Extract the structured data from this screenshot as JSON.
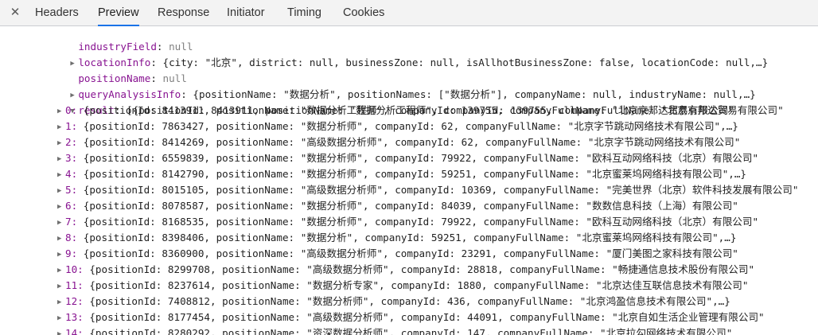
{
  "tabs": {
    "close_glyph": "✕",
    "items": [
      "Headers",
      "Preview",
      "Response",
      "Initiator",
      "Timing",
      "Cookies"
    ],
    "active": "Preview"
  },
  "preview": {
    "industry_field": {
      "key": "industryField",
      "value": "null"
    },
    "location_info": {
      "key": "locationInfo",
      "value": "{city: \"北京\", district: null, businessZone: null, isAllhotBusinessZone: false, locationCode: null,…}"
    },
    "position_name": {
      "key": "positionName",
      "value": "null"
    },
    "query_analysis_info": {
      "key": "queryAnalysisInfo",
      "value": "{positionName: \"数据分析\", positionNames: [\"数据分析\"], companyName: null, industryName: null,…}"
    },
    "result": {
      "key": "result",
      "value": "[{positionId: 8413911, positionName: \"数据分析工程师\", companyId: 139755, companyFullName: \"北京京邦达贸易有限公司\""
    },
    "rows": [
      "{positionId: 8413911, positionName: \"数据分析工程师\", companyId: 139755, companyFullName: \"北京京邦达贸易有限公司\"",
      "{positionId: 7863427, positionName: \"数据分析师\", companyId: 62, companyFullName: \"北京字节跳动网络技术有限公司\",…}",
      "{positionId: 8414269, positionName: \"高级数据分析师\", companyId: 62, companyFullName: \"北京字节跳动网络技术有限公司\"",
      "{positionId: 6559839, positionName: \"数据分析师\", companyId: 79922, companyFullName: \"欧科互动网络科技（北京）有限公司\"",
      "{positionId: 8142790, positionName: \"数据分析师\", companyId: 59251, companyFullName: \"北京蜜莱坞网络科技有限公司\",…}",
      "{positionId: 8015105, positionName: \"高级数据分析师\", companyId: 10369, companyFullName: \"完美世界（北京）软件科技发展有限公司\"",
      "{positionId: 8078587, positionName: \"数据分析师\", companyId: 84039, companyFullName: \"数数信息科技（上海）有限公司\"",
      "{positionId: 8168535, positionName: \"数据分析师\", companyId: 79922, companyFullName: \"欧科互动网络科技（北京）有限公司\"",
      "{positionId: 8398406, positionName: \"数据分析\", companyId: 59251, companyFullName: \"北京蜜莱坞网络科技有限公司\",…}",
      "{positionId: 8360900, positionName: \"高级数据分析师\", companyId: 23291, companyFullName: \"厦门美图之家科技有限公司\"",
      "{positionId: 8299708, positionName: \"高级数据分析师\", companyId: 28818, companyFullName: \"畅捷通信息技术股份有限公司\"",
      "{positionId: 8237614, positionName: \"数据分析专家\", companyId: 1880, companyFullName: \"北京达佳互联信息技术有限公司\"",
      "{positionId: 7408812, positionName: \"数据分析师\", companyId: 436, companyFullName: \"北京鸿盈信息技术有限公司\",…}",
      "{positionId: 8177454, positionName: \"高级数据分析师\", companyId: 44091, companyFullName: \"北京自如生活企业管理有限公司\"",
      "{positionId: 8280292, positionName: \"资深数据分析师\", companyId: 147, companyFullName: \"北京拉勾网络技术有限公司\""
    ],
    "row_labels": [
      "0:",
      "1:",
      "2:",
      "3:",
      "4:",
      "5:",
      "6:",
      "7:",
      "8:",
      "9:",
      "10:",
      "11:",
      "12:",
      "13:",
      "14:"
    ]
  }
}
